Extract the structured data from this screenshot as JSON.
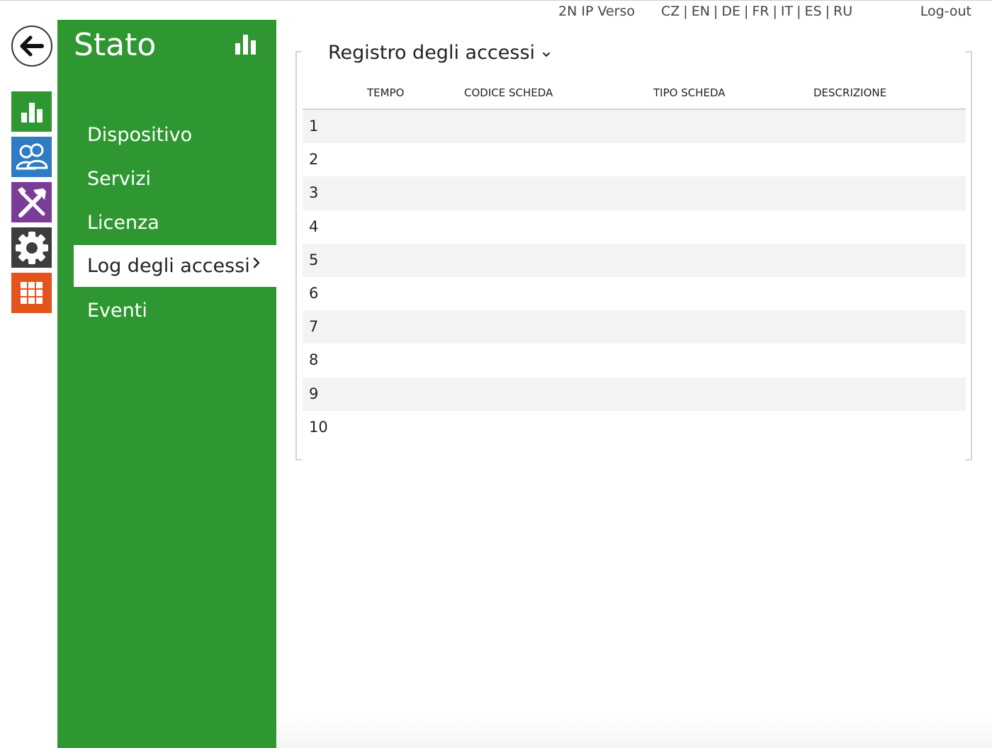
{
  "topbar": {
    "device_name": "2N IP Verso",
    "languages": [
      "CZ",
      "EN",
      "DE",
      "FR",
      "IT",
      "ES",
      "RU"
    ],
    "logout_label": "Log-out"
  },
  "rail": {
    "icons": [
      "back-arrow-icon",
      "status-chart-icon",
      "users-icon",
      "tools-icon",
      "gear-icon",
      "grid-icon"
    ]
  },
  "nav": {
    "title": "Stato",
    "items": [
      {
        "label": "Dispositivo"
      },
      {
        "label": "Servizi"
      },
      {
        "label": "Licenza"
      },
      {
        "label": "Log degli accessi",
        "active": true
      },
      {
        "label": "Eventi"
      }
    ]
  },
  "main": {
    "section_title": "Registro degli accessi",
    "table": {
      "columns": [
        "TEMPO",
        "CODICE SCHEDA",
        "TIPO SCHEDA",
        "DESCRIZIONE"
      ],
      "row_numbers": [
        "1",
        "2",
        "3",
        "4",
        "5",
        "6",
        "7",
        "8",
        "9",
        "10"
      ]
    }
  },
  "colors": {
    "status_green": "#2e9731",
    "users_blue": "#2e7cc4",
    "services_purple": "#7a3c97",
    "hardware_dark": "#3d3d3d",
    "system_orange": "#e3541d"
  }
}
